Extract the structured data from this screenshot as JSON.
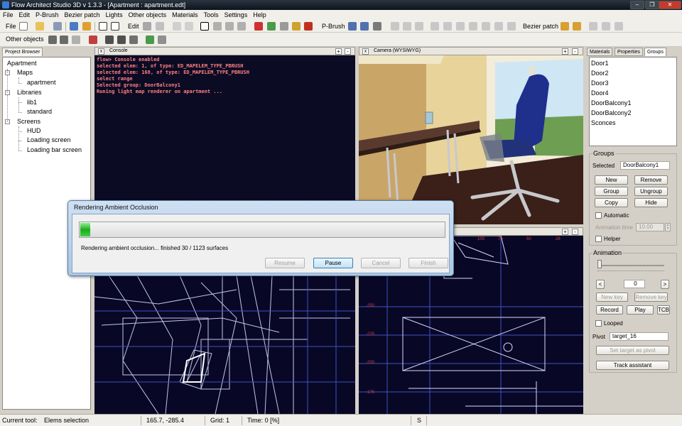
{
  "app": {
    "title": "Flow Architect Studio 3D v 1.3.3 - [Apartment : apartment.edt]",
    "window_buttons": [
      "–",
      "❐",
      "✕"
    ]
  },
  "menu": [
    "File",
    "Edit",
    "P-Brush",
    "Bezier patch",
    "Lights",
    "Other objects",
    "Materials",
    "Tools",
    "Settings",
    "Help"
  ],
  "toolbar": {
    "file_label": "File",
    "edit_label": "Edit",
    "pbrush_label": "P-Brush",
    "bezier_label": "Bezier patch",
    "other_objects_label": "Other objects"
  },
  "project_browser": {
    "tab": "Project Browser",
    "root": "Apartment",
    "maps_label": "Maps",
    "maps": [
      "apartment"
    ],
    "libraries_label": "Libraries",
    "libraries": [
      "lib1",
      "standard"
    ],
    "screens_label": "Screens",
    "screens": [
      "HUD",
      "Loading screen",
      "Loading bar screen"
    ]
  },
  "console": {
    "tab": "Console",
    "lines": [
      "flow> Console enabled",
      "selected elem: 1, of type: ED_MAPELEM_TYPE_PBRUSH",
      "selected elem: 168, of type: ED_MAPELEM_TYPE_PBRUSH",
      "select range",
      "Selected group: DoorBalcony1",
      "Runing light map renderer on apartment ..."
    ]
  },
  "camera_view": {
    "tab": "Camera (WYSIWYG)"
  },
  "wire_view": {
    "top_labels": [
      "100",
      "76",
      "50",
      "26"
    ],
    "side_labels": [
      "-250",
      "-225",
      "-200",
      "-175"
    ]
  },
  "right_panel": {
    "tabs": [
      "Materials",
      "Properties",
      "Groups"
    ],
    "active_tab": "Groups",
    "groups": [
      "Door1",
      "Door2",
      "Door3",
      "Door4",
      "DoorBalcony1",
      "DoorBalcony2",
      "Sconces"
    ],
    "groups_section": {
      "title": "Groups",
      "selected_label": "Selected",
      "selected_value": "DoorBalcony1",
      "new": "New",
      "remove": "Remove",
      "group": "Group",
      "ungroup": "Ungroup",
      "copy": "Copy",
      "hide": "Hide",
      "automatic": "Automatic",
      "animation_time_label": "Animation time",
      "animation_time_value": "10.00",
      "helper": "Helper"
    },
    "animation_section": {
      "title": "Animation",
      "prev": "<",
      "frame_value": "0",
      "next": ">",
      "new_key": "New key",
      "remove_key": "Remove key",
      "record": "Record",
      "play": "Play",
      "tcb": "TCB",
      "looped": "Looped",
      "pivot_label": "Pivot",
      "pivot_value": "target_16",
      "set_target": "Set target as pivot",
      "track_assistant": "Track assistant"
    }
  },
  "dialog": {
    "title": "Rendering Ambient Occlusion",
    "progress_fraction": 0.0267,
    "status": "Rendering ambient occlusion... finished 30 / 1123 surfaces",
    "resume": "Resume",
    "pause": "Pause",
    "cancel": "Cancel",
    "finish": "Finish"
  },
  "status_bar": {
    "tool_label": "Current tool:",
    "tool_value": "Elems selection",
    "coords": "165.7, -285.4",
    "grid": "Grid: 1",
    "time": "Time: 0 [%]",
    "mode": "S"
  },
  "colors": {
    "console_bg": "#0b0b24",
    "console_text": "#ff8080",
    "wire_bg": "#080826",
    "progress_green": "#1faa1f"
  }
}
